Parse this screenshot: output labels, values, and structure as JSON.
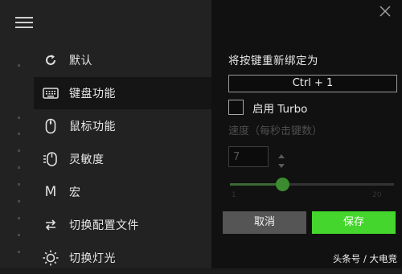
{
  "sidebar": {
    "items": [
      {
        "label": "默认",
        "icon": "refresh-icon"
      },
      {
        "label": "键盘功能",
        "icon": "keyboard-icon"
      },
      {
        "label": "鼠标功能",
        "icon": "mouse-icon"
      },
      {
        "label": "灵敏度",
        "icon": "sensitivity-icon"
      },
      {
        "label": "宏",
        "icon": "macro-icon"
      },
      {
        "label": "切换配置文件",
        "icon": "switch-profile-icon"
      },
      {
        "label": "切换灯光",
        "icon": "lighting-icon"
      }
    ],
    "macro_glyph": "M"
  },
  "panel": {
    "title": "将按键重新绑定为",
    "key_value": "Ctrl + 1",
    "turbo_label": "启用 Turbo",
    "turbo_checked": false,
    "speed_label": "速度（每秒击键数）",
    "speed_value": "7",
    "slider_fraction": 0.32,
    "slider_min": "1",
    "slider_max": "20",
    "cancel_label": "取消",
    "save_label": "保存"
  },
  "watermark": "头条号 / 大电竞",
  "colors": {
    "accent": "#44d62c",
    "sidebar_bg": "#222222",
    "panel_bg": "#111111"
  }
}
